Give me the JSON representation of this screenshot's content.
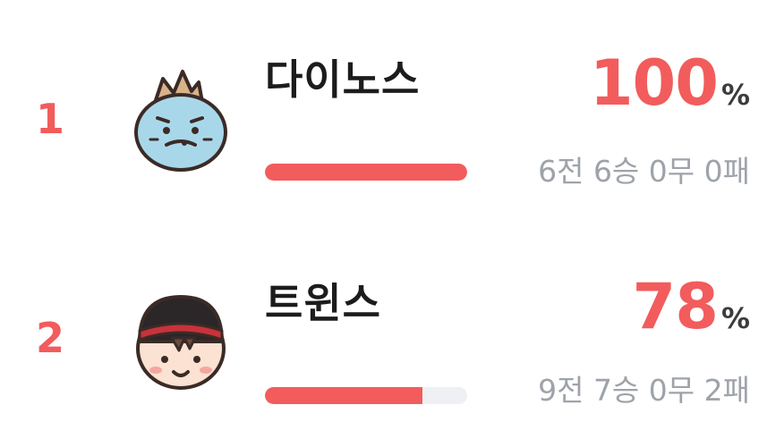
{
  "standings": [
    {
      "rank": "1",
      "team": "다이노스",
      "win_rate": "100",
      "percent_sign": "%",
      "win_rate_fraction": 1.0,
      "record": "6전 6승 0무 0패",
      "avatar": "dinosaur-mascot-icon"
    },
    {
      "rank": "2",
      "team": "트윈스",
      "win_rate": "78",
      "percent_sign": "%",
      "win_rate_fraction": 0.78,
      "record": "9전 7승 0무 2패",
      "avatar": "twins-player-mascot-icon"
    }
  ],
  "colors": {
    "accent": "#f25c5c",
    "track": "#eef0f3",
    "muted_text": "#9ea3a9",
    "title_text": "#1c1c1c"
  }
}
